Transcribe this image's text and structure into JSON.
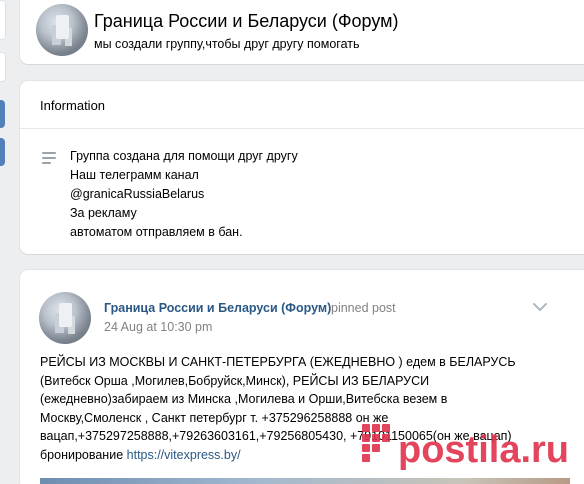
{
  "group": {
    "title": "Граница России и Беларуси (Форум)",
    "status": "мы создали группу,чтобы друг другу помогать"
  },
  "info": {
    "header": "Information",
    "icon": "description-lines-icon",
    "lines": [
      "Группа создана для помощи друг другу",
      "Наш телеграмм канал",
      "@granicaRussiaBelarus",
      "За рекламу",
      "автоматом отправляем в бан."
    ]
  },
  "post": {
    "author": "Граница России и Беларуси (Форум)",
    "pinned": "pinned post",
    "date": "24 Aug at 10:30 pm",
    "text_lines": [
      "РЕЙСЫ ИЗ МОСКВЫ И САНКТ-ПЕТЕРБУРГА (ЕЖЕДНЕВНО ) едем в БЕЛАРУСЬ",
      "(Витебск Орша ,Могилев,Бобруйск,Минск), РЕЙСЫ ИЗ БЕЛАРУСИ",
      "(ежедневно)забираем из Минска ,Могилева и Орши,Витебска везем в",
      "Москву,Смоленск , Санкт петербург т. +375296258888 он же",
      "вацап,+375297258888,+79263603161,+79256805430, +79101150065(он же вацап)"
    ],
    "booking_label": "бронирование",
    "link": "https://vitexpress.by/"
  },
  "watermark": {
    "text": "postila.ru",
    "color": "#e0314b"
  },
  "colors": {
    "background": "#edeef0",
    "link": "#2a5885",
    "muted": "#828282",
    "accent_blue": "#5181b8"
  }
}
